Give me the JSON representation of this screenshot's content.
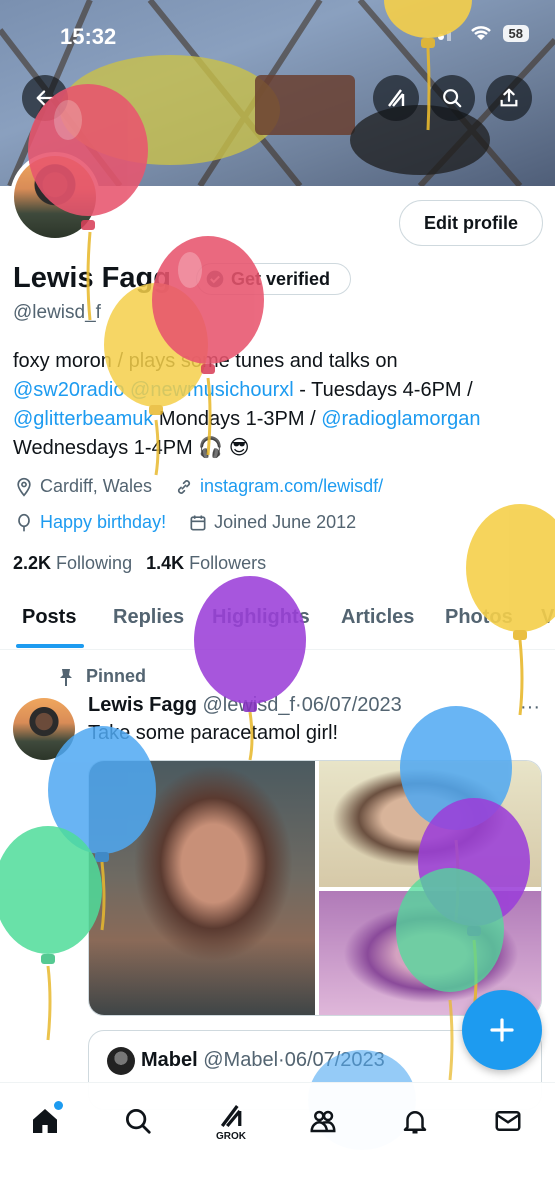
{
  "status_bar": {
    "time": "15:32",
    "battery": "58"
  },
  "header": {
    "back_icon": "arrow-left-icon",
    "grok_icon": "grok-icon",
    "search_icon": "search-icon",
    "share_icon": "share-icon"
  },
  "profile": {
    "name": "Lewis Fagg",
    "get_verified_label": "Get verified",
    "handle": "@lewisd_f",
    "edit_profile_label": "Edit profile",
    "bio": {
      "part1": "foxy moron / plays some tunes and talks on",
      "mention1": "@sw20radio",
      "mention2": "@newmusichourxl",
      "part2": " - Tuesdays 4-6PM /",
      "mention3": "@glitterbeamuk",
      "part3": " Mondays 1-3PM / ",
      "mention4": "@radioglamorgan",
      "part4": "Wednesdays 1-4PM 🎧 😎"
    },
    "location": "Cardiff, Wales",
    "website": "instagram.com/lewisdf/",
    "birthday": "Happy birthday!",
    "joined": "Joined June 2012",
    "following_count": "2.2K",
    "following_label": "Following",
    "followers_count": "1.4K",
    "followers_label": "Followers"
  },
  "tabs": [
    "Posts",
    "Replies",
    "Highlights",
    "Articles",
    "Photos",
    "V"
  ],
  "post": {
    "pinned_label": "Pinned",
    "author_name": "Lewis Fagg",
    "author_handle": "@lewisd_f",
    "dot": "·",
    "date": "06/07/2023",
    "more": "···",
    "text": "Take some paracetamol girl!",
    "quote": {
      "author_name": "Mabel",
      "author_handle": "@Mabel",
      "dot": "·",
      "date": "06/07/2023"
    }
  },
  "compose_icon": "plus-icon",
  "bottom_nav": {
    "home_icon": "home-icon",
    "search_icon": "search-icon",
    "grok_label": "GROK",
    "communities_icon": "communities-icon",
    "notifications_icon": "bell-icon",
    "messages_icon": "mail-icon"
  },
  "colors": {
    "accent": "#1d9bf0",
    "text": "#0f1419",
    "secondary": "#536471",
    "balloon_red": "#e8556e",
    "balloon_yellow": "#f5cf4a",
    "balloon_purple": "#9b3fd8",
    "balloon_blue": "#4fa8f2",
    "balloon_green": "#4fdc9a"
  }
}
